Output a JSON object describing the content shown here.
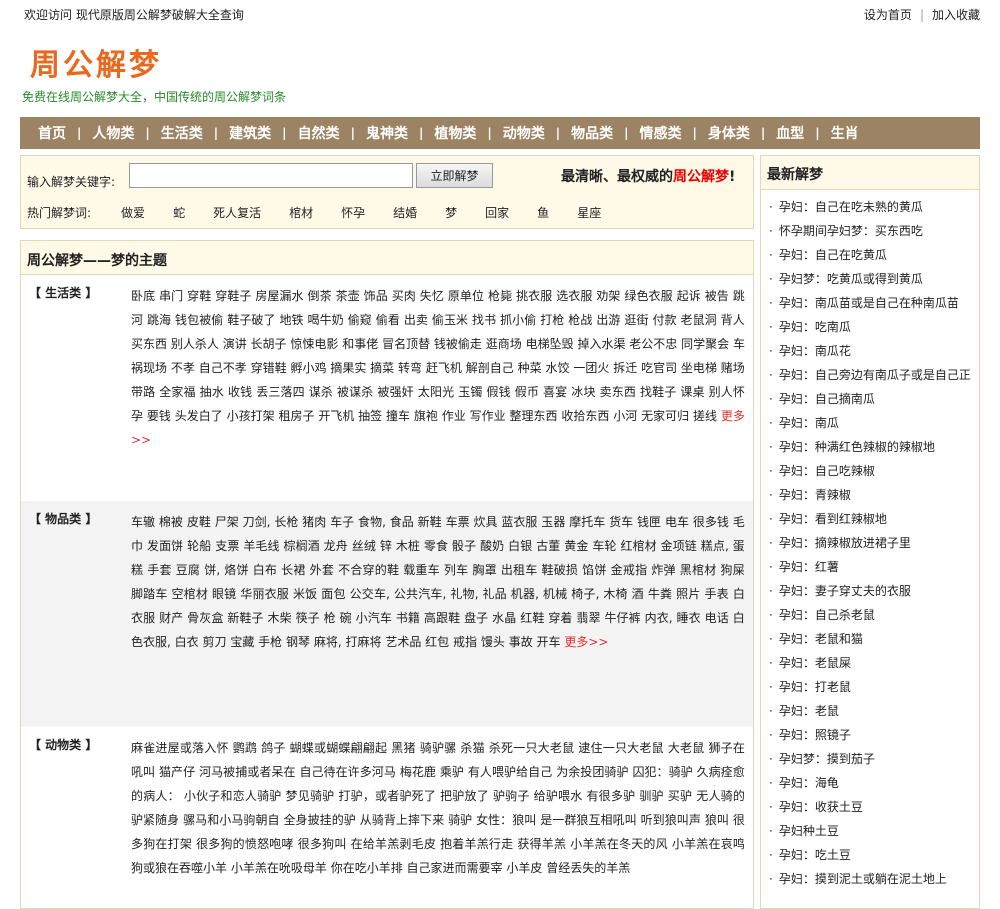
{
  "topbar": {
    "welcome": "欢迎访问 现代原版周公解梦破解大全查询",
    "set_home": "设为首页",
    "bookmark": "加入收藏"
  },
  "header": {
    "logo": "周公解梦",
    "slogan": "免费在线周公解梦大全，中国传统的周公解梦词条"
  },
  "nav": [
    "首页",
    "人物类",
    "生活类",
    "建筑类",
    "自然类",
    "鬼神类",
    "植物类",
    "动物类",
    "物品类",
    "情感类",
    "身体类",
    "血型",
    "生肖"
  ],
  "search": {
    "label": "输入解梦关键字:",
    "value": "",
    "button": "立即解梦",
    "tagline_pre": "最清晰、最权威的",
    "tagline_red": "周公解梦",
    "tagline_post": "!",
    "hot_label": "热门解梦词:",
    "hot": [
      "做爱",
      "蛇",
      "死人复活",
      "棺材",
      "怀孕",
      "结婚",
      "梦",
      "回家",
      "鱼",
      "星座"
    ]
  },
  "main": {
    "title": "周公解梦——梦的主题",
    "more": "更多>>",
    "categories": [
      {
        "name": "【 生活类 】",
        "words": [
          "卧底",
          "串门",
          "穿鞋",
          "穿鞋子",
          "房屋漏水",
          "倒茶",
          "茶壶",
          "饰品",
          "买肉",
          "失忆",
          "原单位",
          "枪毙",
          "挑衣服",
          "选衣服",
          "劝架",
          "绿色衣服",
          "起诉",
          "被告",
          "跳河",
          "跳海",
          "钱包被偷",
          "鞋子破了",
          "地铁",
          "喝牛奶",
          "偷窥",
          "偷看",
          "出卖",
          "偷玉米",
          "找书",
          "抓小偷",
          "打枪",
          "枪战",
          "出游",
          "逛街",
          "付款",
          "老鼠洞",
          "背人",
          "买东西",
          "别人杀人",
          "演讲",
          "长胡子",
          "惊悚电影",
          "和事佬",
          "冒名顶替",
          "钱被偷走",
          "逛商场",
          "电梯坠毁",
          "掉入水渠",
          "老公不忠",
          "同学聚会",
          "车祸现场",
          "不孝",
          "自己不孝",
          "穿错鞋",
          "孵小鸡",
          "摘果实",
          "摘菜",
          "转弯",
          "赶飞机",
          "解剖自己",
          "种菜",
          "水饺",
          "一团火",
          "拆迁",
          "吃官司",
          "坐电梯",
          "赌场",
          "带路",
          "全家福",
          "抽水",
          "收钱",
          "丢三落四",
          "谋杀",
          "被谋杀",
          "被强奸",
          "太阳光",
          "玉镯",
          "假钱",
          "假币",
          "喜宴",
          "冰块",
          "卖东西",
          "找鞋子",
          "课桌",
          "别人怀孕",
          "要钱",
          "头发白了",
          "小孩打架",
          "租房子",
          "开飞机",
          "抽签",
          "撞车",
          "旗袍",
          "作业",
          "写作业",
          "整理东西",
          "收拾东西",
          "小河",
          "无家可归",
          "搓线"
        ]
      },
      {
        "name": "【 物品类 】",
        "words": [
          "车辙",
          "棉被",
          "皮鞋",
          "尸架",
          "刀剑, 长枪",
          "猪肉",
          "车子",
          "食物, 食品",
          "新鞋",
          "车票",
          "炊具",
          "蓝衣服",
          "玉器",
          "摩托车",
          "货车",
          "钱匣",
          "电车",
          "很多钱",
          "毛巾",
          "发面饼",
          "轮船",
          "支票",
          "羊毛线",
          "棕榈酒",
          "龙舟",
          "丝绒",
          "锌",
          "木桩",
          "零食",
          "骰子",
          "酸奶",
          "白银",
          "古董",
          "黄金",
          "车轮",
          "红棺材",
          "金项链",
          "糕点, 蛋糕",
          "手套",
          "豆腐",
          "饼, 烙饼",
          "白布",
          "长裙",
          "外套",
          "不合穿的鞋",
          "载重车",
          "列车",
          "胸罩",
          "出租车",
          "鞋破损",
          "馅饼",
          "金戒指",
          "炸弹",
          "黑棺材",
          "狗屎",
          "脚踏车",
          "空棺材",
          "眼镜",
          "华丽衣服",
          "米饭",
          "面包",
          "公交车, 公共汽车,",
          "礼物, 礼品",
          "机器, 机械",
          "椅子, 木椅",
          "酒",
          "牛粪",
          "照片",
          "手表",
          "白衣服",
          "财产",
          "骨灰盒",
          "新鞋子",
          "木柴",
          "筷子",
          "枪",
          "碗",
          "小汽车",
          "书籍",
          "高跟鞋",
          "盘子",
          "水晶",
          "红鞋",
          "穿着",
          "翡翠",
          "牛仔裤",
          "内衣, 睡衣",
          "电话",
          "白色衣服, 白衣",
          "剪刀",
          "宝藏",
          "手枪",
          "钢琴",
          "麻将, 打麻将",
          "艺术品",
          "红包",
          "戒指",
          "馒头",
          "事故",
          "开车"
        ]
      },
      {
        "name": "【 动物类 】",
        "words": [
          "麻雀进屋或落入怀",
          "鹦鹉",
          "鸽子",
          "蝴蝶或蝴蝶翩翩起",
          "黑猪",
          "骑驴骡",
          "杀猫",
          "杀死一只大老鼠",
          "逮住一只大老鼠",
          "大老鼠",
          "狮子在吼叫",
          "猫产仔",
          "河马被捕或者呆在",
          "自己待在许多河马",
          "梅花鹿",
          "乘驴",
          "有人喂驴给自己",
          "为余投团骑驴",
          "囚犯：骑驴",
          "久病痊愈的病人：",
          "小伙子和恋人骑驴",
          "梦见骑驴",
          "打驴，或者驴死了",
          "把驴放了",
          "驴驹子",
          "给驴喂水",
          "有很多驴",
          "驯驴",
          "买驴",
          "无人骑的驴紧随身",
          "骡马和小马驹朝自",
          "全身披挂的驴",
          "从骑背上摔下来",
          "骑驴",
          "女性：狼叫",
          "是一群狼互相吼叫",
          "听到狼叫声",
          "狼叫",
          "很多狗在打架",
          "很多狗的愤怒咆哮",
          "很多狗叫",
          "在给羊羔剥毛皮",
          "抱着羊羔行走",
          "获得羊羔",
          "小羊羔在冬天的风",
          "小羊羔在哀鸣",
          "狗或狼在吞噬小羊",
          "小羊羔在吮吸母羊",
          "你在吃小羊排",
          "自己家进而需要宰",
          "小羊皮",
          "曾经丢失的羊羔"
        ]
      }
    ]
  },
  "sidebar": {
    "title": "最新解梦",
    "items": [
      "孕妇：自己在吃未熟的黄瓜",
      "怀孕期间孕妇梦：买东西吃",
      "孕妇：自己在吃黄瓜",
      "孕妇梦：吃黄瓜或得到黄瓜",
      "孕妇：南瓜苗或是自己在种南瓜苗",
      "孕妇：吃南瓜",
      "孕妇：南瓜花",
      "孕妇：自己旁边有南瓜子或是自己正",
      "孕妇：自己摘南瓜",
      "孕妇：南瓜",
      "孕妇：种满红色辣椒的辣椒地",
      "孕妇：自己吃辣椒",
      "孕妇：青辣椒",
      "孕妇：看到红辣椒地",
      "孕妇：摘辣椒放进裙子里",
      "孕妇：红薯",
      "孕妇：妻子穿丈夫的衣服",
      "孕妇：自己杀老鼠",
      "孕妇：老鼠和猫",
      "孕妇：老鼠屎",
      "孕妇：打老鼠",
      "孕妇：老鼠",
      "孕妇：照镜子",
      "孕妇梦：摸到茄子",
      "孕妇：海龟",
      "孕妇：收获土豆",
      "孕妇种土豆",
      "孕妇：吃土豆",
      "孕妇：摸到泥土或躺在泥土地上"
    ]
  }
}
